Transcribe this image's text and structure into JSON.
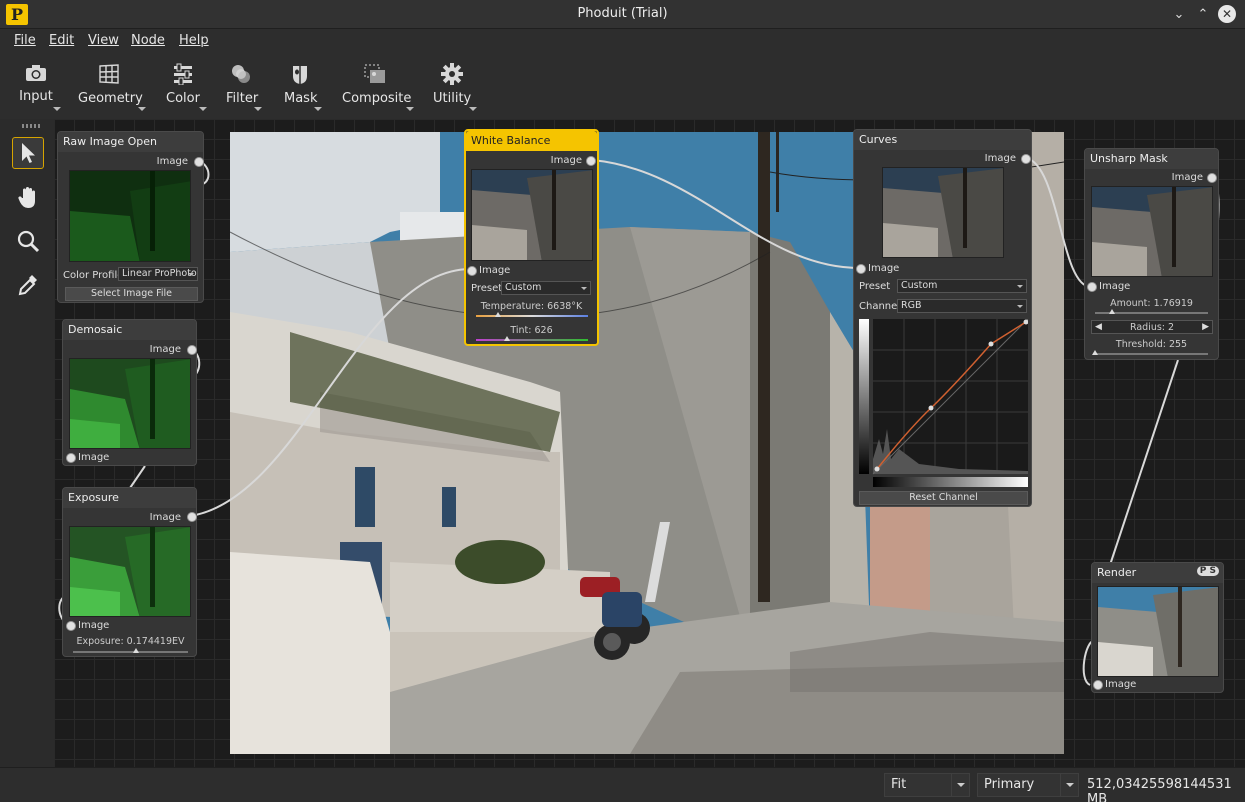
{
  "window": {
    "title": "Phoduit (Trial)",
    "logo": "P"
  },
  "menu": [
    "File",
    "Edit",
    "View",
    "Node",
    "Help"
  ],
  "toolbar": [
    {
      "label": "Input",
      "icon": "camera-icon"
    },
    {
      "label": "Geometry",
      "icon": "grid-icon"
    },
    {
      "label": "Color",
      "icon": "sliders-icon"
    },
    {
      "label": "Filter",
      "icon": "filter-circles-icon"
    },
    {
      "label": "Mask",
      "icon": "mask-icon"
    },
    {
      "label": "Composite",
      "icon": "composite-icon"
    },
    {
      "label": "Utility",
      "icon": "gear-icon"
    }
  ],
  "left_tools": [
    "pointer-icon",
    "hand-icon",
    "magnifier-icon",
    "eyedropper-icon"
  ],
  "nodes": {
    "raw": {
      "title": "Raw Image Open",
      "out": "Image",
      "color_profile_label": "Color Profile",
      "color_profile_value": "Linear ProPhoto",
      "select_button": "Select Image File"
    },
    "demosaic": {
      "title": "Demosaic",
      "out": "Image",
      "in": "Image"
    },
    "exposure": {
      "title": "Exposure",
      "out": "Image",
      "in": "Image",
      "exposure_label": "Exposure: 0.174419EV",
      "exposure_fraction": 0.55
    },
    "white_balance": {
      "title": "White Balance",
      "out": "Image",
      "in": "Image",
      "preset_label": "Preset",
      "preset_value": "Custom",
      "temperature_label": "Temperature: 6638°K",
      "tint_label": "Tint: 626",
      "temperature_fraction": 0.2,
      "tint_fraction": 0.28
    },
    "curves": {
      "title": "Curves",
      "out": "Image",
      "in": "Image",
      "preset_label": "Preset",
      "preset_value": "Custom",
      "channel_label": "Channel",
      "channel_value": "RGB",
      "reset_button": "Reset Channel"
    },
    "unsharp": {
      "title": "Unsharp Mask",
      "out": "Image",
      "in": "Image",
      "amount_label": "Amount: 1.76919",
      "radius_label": "Radius: 2",
      "threshold_label": "Threshold: 255",
      "amount_fraction": 0.15,
      "threshold_fraction": 0.0
    },
    "render": {
      "title": "Render",
      "in": "Image",
      "badge": "P S"
    }
  },
  "status": {
    "zoom": "Fit",
    "view": "Primary",
    "memory": "512,03425598144531 MB"
  },
  "colors": {
    "accent": "#f5c400",
    "panel": "#353535",
    "canvas": "#1c1c1c",
    "sky": "#3f7fa8"
  }
}
